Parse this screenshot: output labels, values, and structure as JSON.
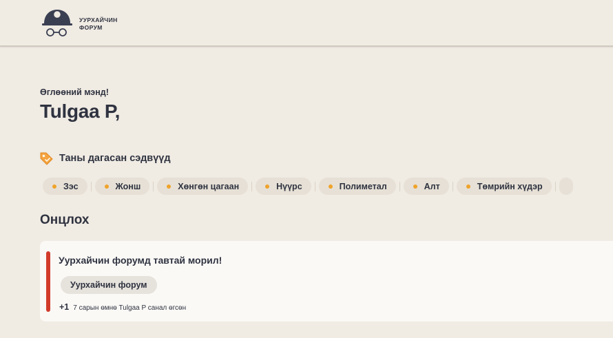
{
  "brand": {
    "line1": "УУРХАЙЧИН",
    "line2": "ФОРУМ",
    "logo_icon": "miner-helmet-glasses-icon"
  },
  "welcome": {
    "greeting": "Өглөөний мэнд!",
    "username": "Tulgaa P,"
  },
  "followed_topics": {
    "title": "Таны дагасан сэдвүүд",
    "icon": "tag-icon",
    "dot_color": "#f0a32a",
    "items": [
      "Зэс",
      "Жонш",
      "Хөнгөн цагаан",
      "Нүүрс",
      "Полиметал",
      "Алт",
      "Төмрийн хүдэр"
    ]
  },
  "featured": {
    "title": "Онцлох",
    "post": {
      "title": "Уурхайчин форумд тавтай морил!",
      "category": "Уурхайчин форум",
      "votes": "+1",
      "meta": "7 сарын өмнө Tulgaa P санал өгсөн",
      "accent_color": "#d23b2a"
    }
  }
}
